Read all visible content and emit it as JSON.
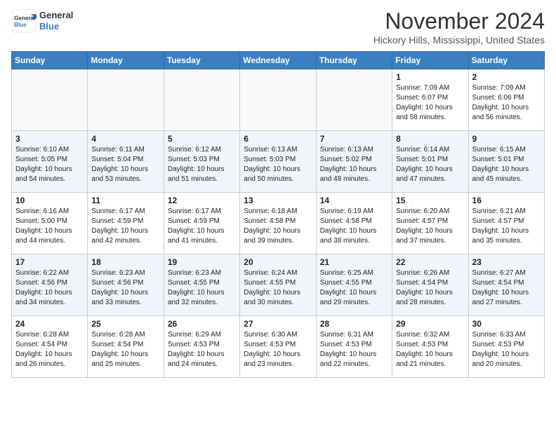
{
  "header": {
    "logo_line1": "General",
    "logo_line2": "Blue",
    "month": "November 2024",
    "location": "Hickory Hills, Mississippi, United States"
  },
  "weekdays": [
    "Sunday",
    "Monday",
    "Tuesday",
    "Wednesday",
    "Thursday",
    "Friday",
    "Saturday"
  ],
  "weeks": [
    [
      {
        "day": "",
        "info": ""
      },
      {
        "day": "",
        "info": ""
      },
      {
        "day": "",
        "info": ""
      },
      {
        "day": "",
        "info": ""
      },
      {
        "day": "",
        "info": ""
      },
      {
        "day": "1",
        "info": "Sunrise: 7:09 AM\nSunset: 6:07 PM\nDaylight: 10 hours\nand 58 minutes."
      },
      {
        "day": "2",
        "info": "Sunrise: 7:09 AM\nSunset: 6:06 PM\nDaylight: 10 hours\nand 56 minutes."
      }
    ],
    [
      {
        "day": "3",
        "info": "Sunrise: 6:10 AM\nSunset: 5:05 PM\nDaylight: 10 hours\nand 54 minutes."
      },
      {
        "day": "4",
        "info": "Sunrise: 6:11 AM\nSunset: 5:04 PM\nDaylight: 10 hours\nand 53 minutes."
      },
      {
        "day": "5",
        "info": "Sunrise: 6:12 AM\nSunset: 5:03 PM\nDaylight: 10 hours\nand 51 minutes."
      },
      {
        "day": "6",
        "info": "Sunrise: 6:13 AM\nSunset: 5:03 PM\nDaylight: 10 hours\nand 50 minutes."
      },
      {
        "day": "7",
        "info": "Sunrise: 6:13 AM\nSunset: 5:02 PM\nDaylight: 10 hours\nand 48 minutes."
      },
      {
        "day": "8",
        "info": "Sunrise: 6:14 AM\nSunset: 5:01 PM\nDaylight: 10 hours\nand 47 minutes."
      },
      {
        "day": "9",
        "info": "Sunrise: 6:15 AM\nSunset: 5:01 PM\nDaylight: 10 hours\nand 45 minutes."
      }
    ],
    [
      {
        "day": "10",
        "info": "Sunrise: 6:16 AM\nSunset: 5:00 PM\nDaylight: 10 hours\nand 44 minutes."
      },
      {
        "day": "11",
        "info": "Sunrise: 6:17 AM\nSunset: 4:59 PM\nDaylight: 10 hours\nand 42 minutes."
      },
      {
        "day": "12",
        "info": "Sunrise: 6:17 AM\nSunset: 4:59 PM\nDaylight: 10 hours\nand 41 minutes."
      },
      {
        "day": "13",
        "info": "Sunrise: 6:18 AM\nSunset: 4:58 PM\nDaylight: 10 hours\nand 39 minutes."
      },
      {
        "day": "14",
        "info": "Sunrise: 6:19 AM\nSunset: 4:58 PM\nDaylight: 10 hours\nand 38 minutes."
      },
      {
        "day": "15",
        "info": "Sunrise: 6:20 AM\nSunset: 4:57 PM\nDaylight: 10 hours\nand 37 minutes."
      },
      {
        "day": "16",
        "info": "Sunrise: 6:21 AM\nSunset: 4:57 PM\nDaylight: 10 hours\nand 35 minutes."
      }
    ],
    [
      {
        "day": "17",
        "info": "Sunrise: 6:22 AM\nSunset: 4:56 PM\nDaylight: 10 hours\nand 34 minutes."
      },
      {
        "day": "18",
        "info": "Sunrise: 6:23 AM\nSunset: 4:56 PM\nDaylight: 10 hours\nand 33 minutes."
      },
      {
        "day": "19",
        "info": "Sunrise: 6:23 AM\nSunset: 4:55 PM\nDaylight: 10 hours\nand 32 minutes."
      },
      {
        "day": "20",
        "info": "Sunrise: 6:24 AM\nSunset: 4:55 PM\nDaylight: 10 hours\nand 30 minutes."
      },
      {
        "day": "21",
        "info": "Sunrise: 6:25 AM\nSunset: 4:55 PM\nDaylight: 10 hours\nand 29 minutes."
      },
      {
        "day": "22",
        "info": "Sunrise: 6:26 AM\nSunset: 4:54 PM\nDaylight: 10 hours\nand 28 minutes."
      },
      {
        "day": "23",
        "info": "Sunrise: 6:27 AM\nSunset: 4:54 PM\nDaylight: 10 hours\nand 27 minutes."
      }
    ],
    [
      {
        "day": "24",
        "info": "Sunrise: 6:28 AM\nSunset: 4:54 PM\nDaylight: 10 hours\nand 26 minutes."
      },
      {
        "day": "25",
        "info": "Sunrise: 6:28 AM\nSunset: 4:54 PM\nDaylight: 10 hours\nand 25 minutes."
      },
      {
        "day": "26",
        "info": "Sunrise: 6:29 AM\nSunset: 4:53 PM\nDaylight: 10 hours\nand 24 minutes."
      },
      {
        "day": "27",
        "info": "Sunrise: 6:30 AM\nSunset: 4:53 PM\nDaylight: 10 hours\nand 23 minutes."
      },
      {
        "day": "28",
        "info": "Sunrise: 6:31 AM\nSunset: 4:53 PM\nDaylight: 10 hours\nand 22 minutes."
      },
      {
        "day": "29",
        "info": "Sunrise: 6:32 AM\nSunset: 4:53 PM\nDaylight: 10 hours\nand 21 minutes."
      },
      {
        "day": "30",
        "info": "Sunrise: 6:33 AM\nSunset: 4:53 PM\nDaylight: 10 hours\nand 20 minutes."
      }
    ]
  ]
}
